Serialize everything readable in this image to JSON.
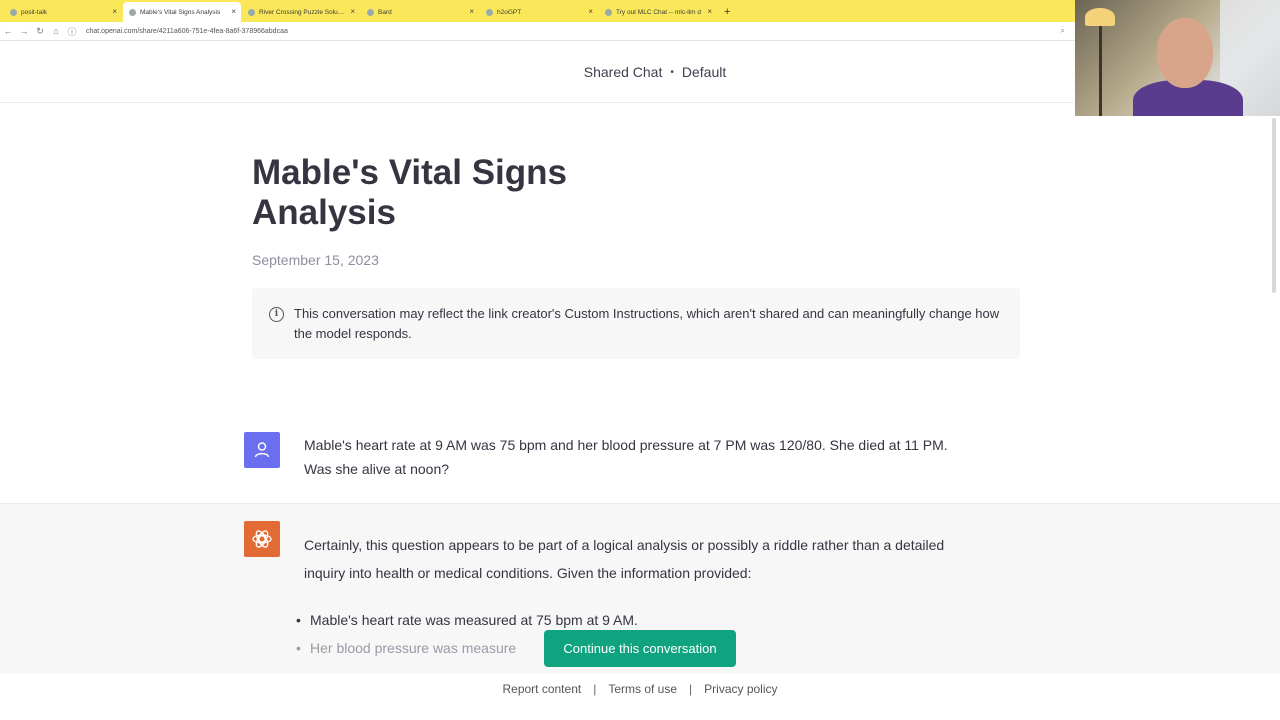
{
  "browser": {
    "tabs": [
      {
        "label": "posit-talk"
      },
      {
        "label": "Mable's Vital Signs Analysis",
        "active": true
      },
      {
        "label": "River Crossing Puzzle Solution"
      },
      {
        "label": "Bard"
      },
      {
        "label": "h2oGPT"
      },
      {
        "label": "Try out MLC Chat -- mlc-llm d"
      }
    ],
    "new_tab": "+",
    "url": "chat.openai.com/share/4211a606-751e-4fea-8a6f-378966abdcaa"
  },
  "header": {
    "shared_label": "Shared Chat",
    "separator": "•",
    "model_label": "Default"
  },
  "conversation": {
    "title": "Mable's Vital Signs Analysis",
    "date": "September 15, 2023",
    "notice": "This conversation may reflect the link creator's Custom Instructions, which aren't shared and can meaningfully change how the model responds.",
    "user_message": "Mable's heart rate at 9 AM was 75 bpm and her blood pressure at 7 PM was 120/80. She died at 11 PM. Was she alive at noon?",
    "assistant_message": "Certainly, this question appears to be part of a logical analysis or possibly a riddle rather than a detailed inquiry into health or medical conditions. Given the information provided:",
    "assistant_bullets": [
      "Mable's heart rate was measured at 75 bpm at 9 AM.",
      "Her blood pressure was measure"
    ]
  },
  "actions": {
    "continue_label": "Continue this conversation"
  },
  "footer": {
    "links": [
      "Report content",
      "Terms of use",
      "Privacy policy"
    ],
    "separator": "|"
  },
  "colors": {
    "tabbar": "#fbe85a",
    "continue_button": "#10a37f",
    "user_avatar": "#6a6ff0",
    "assistant_avatar": "#e26b35"
  }
}
